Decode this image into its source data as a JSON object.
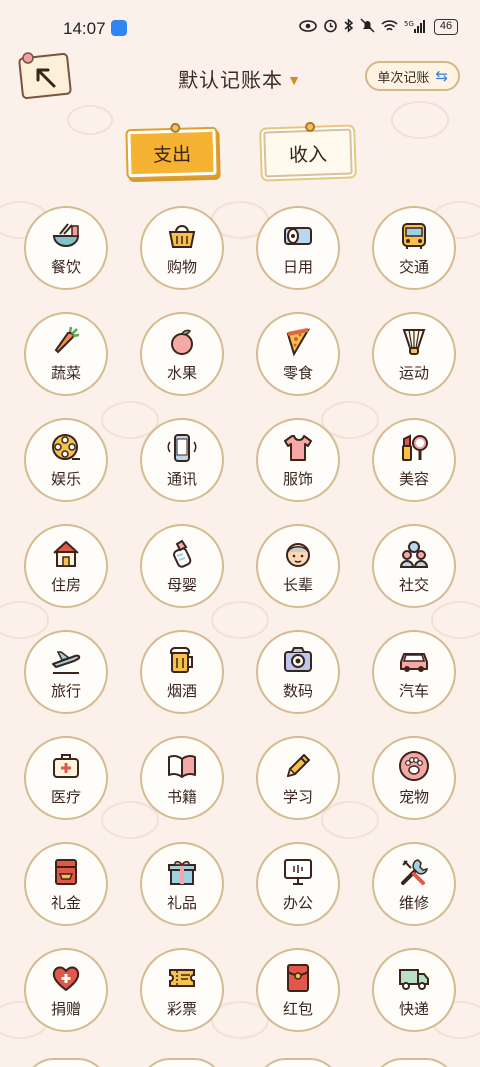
{
  "status_bar": {
    "time": "14:07",
    "battery": "46",
    "network": "5G"
  },
  "header": {
    "book_name": "默认记账本",
    "single_mode_label": "单次记账"
  },
  "tabs": [
    {
      "label": "支出",
      "active": true
    },
    {
      "label": "收入",
      "active": false
    }
  ],
  "categories": [
    {
      "label": "餐饮",
      "icon": "bowl-icon"
    },
    {
      "label": "购物",
      "icon": "basket-icon"
    },
    {
      "label": "日用",
      "icon": "tissue-roll-icon"
    },
    {
      "label": "交通",
      "icon": "bus-icon"
    },
    {
      "label": "蔬菜",
      "icon": "carrot-icon"
    },
    {
      "label": "水果",
      "icon": "peach-icon"
    },
    {
      "label": "零食",
      "icon": "pizza-icon"
    },
    {
      "label": "运动",
      "icon": "shuttlecock-icon"
    },
    {
      "label": "娱乐",
      "icon": "film-reel-icon"
    },
    {
      "label": "通讯",
      "icon": "phone-icon"
    },
    {
      "label": "服饰",
      "icon": "tshirt-icon"
    },
    {
      "label": "美容",
      "icon": "lipstick-mirror-icon"
    },
    {
      "label": "住房",
      "icon": "house-icon"
    },
    {
      "label": "母婴",
      "icon": "baby-bottle-icon"
    },
    {
      "label": "长辈",
      "icon": "elder-face-icon"
    },
    {
      "label": "社交",
      "icon": "people-icon"
    },
    {
      "label": "旅行",
      "icon": "airplane-icon"
    },
    {
      "label": "烟酒",
      "icon": "beer-mug-icon"
    },
    {
      "label": "数码",
      "icon": "camera-icon"
    },
    {
      "label": "汽车",
      "icon": "car-icon"
    },
    {
      "label": "医疗",
      "icon": "medical-kit-icon"
    },
    {
      "label": "书籍",
      "icon": "book-icon"
    },
    {
      "label": "学习",
      "icon": "pencil-icon"
    },
    {
      "label": "宠物",
      "icon": "paw-icon"
    },
    {
      "label": "礼金",
      "icon": "gift-money-icon"
    },
    {
      "label": "礼品",
      "icon": "gift-box-icon"
    },
    {
      "label": "办公",
      "icon": "monitor-icon"
    },
    {
      "label": "维修",
      "icon": "tools-icon"
    },
    {
      "label": "捐赠",
      "icon": "heart-plus-icon"
    },
    {
      "label": "彩票",
      "icon": "ticket-icon"
    },
    {
      "label": "红包",
      "icon": "red-envelope-icon"
    },
    {
      "label": "快递",
      "icon": "truck-icon"
    }
  ]
}
